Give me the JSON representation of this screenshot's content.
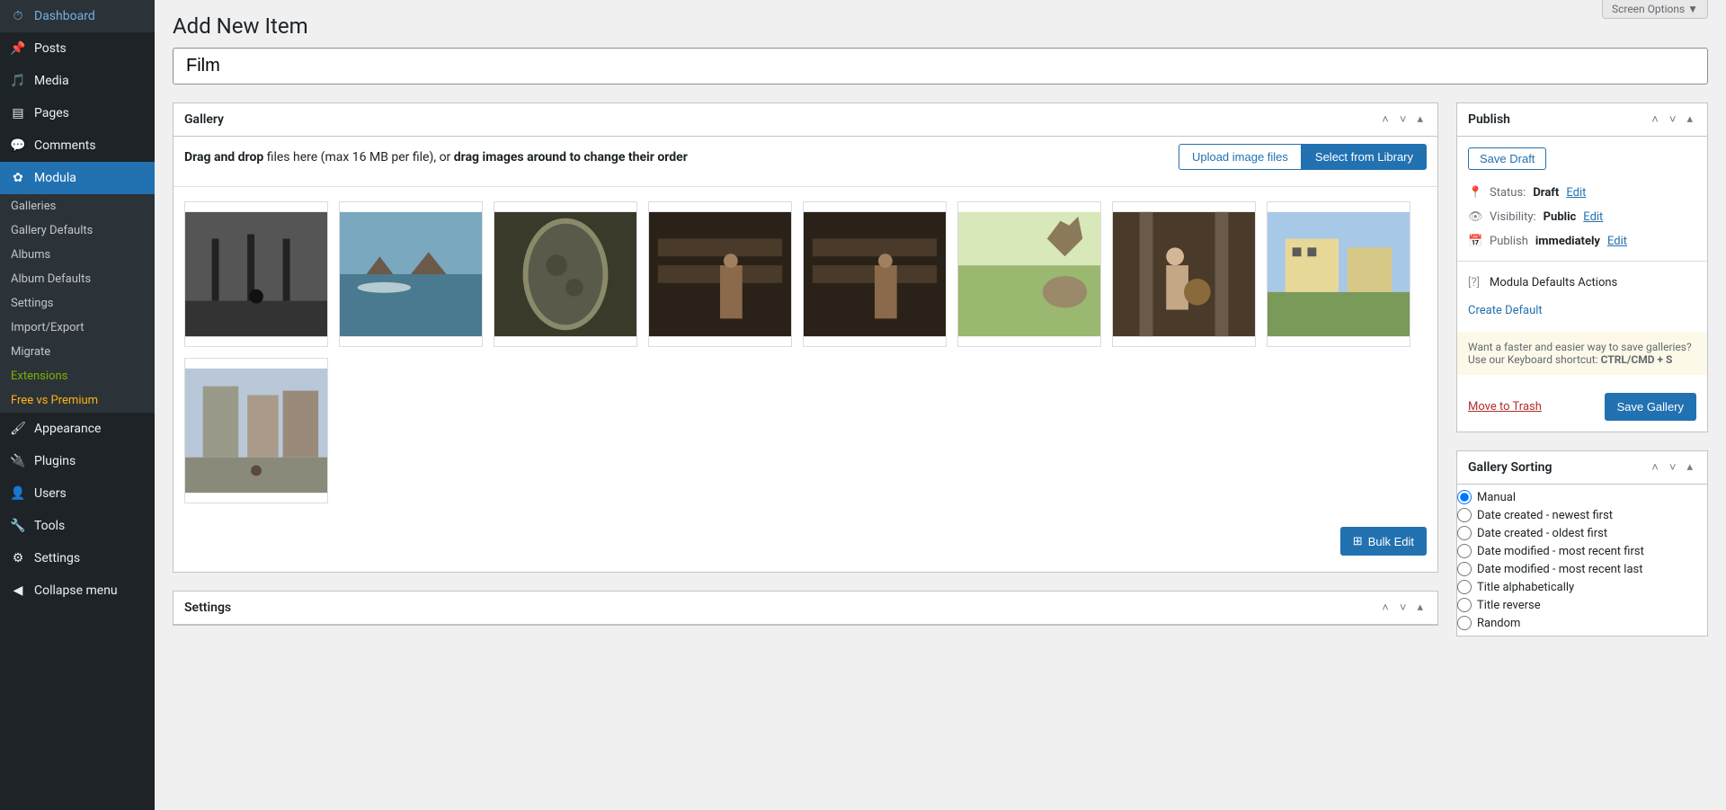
{
  "screenOptions": "Screen Options ▼",
  "sidebar": {
    "dashboard": "Dashboard",
    "posts": "Posts",
    "media": "Media",
    "pages": "Pages",
    "comments": "Comments",
    "modula": "Modula",
    "modulaSub": {
      "galleries": "Galleries",
      "galleryDefaults": "Gallery Defaults",
      "albums": "Albums",
      "albumDefaults": "Album Defaults",
      "settings": "Settings",
      "importExport": "Import/Export",
      "migrate": "Migrate",
      "extensions": "Extensions",
      "freeVsPremium": "Free vs Premium"
    },
    "appearance": "Appearance",
    "plugins": "Plugins",
    "users": "Users",
    "tools": "Tools",
    "settings": "Settings",
    "collapse": "Collapse menu"
  },
  "pageTitle": "Add New Item",
  "titleValue": "Film",
  "gallery": {
    "title": "Gallery",
    "uploadText1": "Drag and drop",
    "uploadText2": " files here (max 16 MB per file), or ",
    "uploadText3": "drag images around to change their order",
    "uploadBtn": "Upload image files",
    "libraryBtn": "Select from Library",
    "bulkEdit": "Bulk Edit"
  },
  "settings": {
    "title": "Settings"
  },
  "publish": {
    "title": "Publish",
    "saveDraft": "Save Draft",
    "statusLabel": "Status:",
    "statusValue": "Draft",
    "visibilityLabel": "Visibility:",
    "visibilityValue": "Public",
    "publishLabel": "Publish",
    "publishValue": "immediately",
    "edit": "Edit",
    "modulaDefaults": "Modula Defaults Actions",
    "createDefault": "Create Default",
    "tip1": "Want a faster and easier way to save galleries? Use our Keyboard shortcut: ",
    "tip2": "CTRL/CMD + S",
    "moveToTrash": "Move to Trash",
    "saveGallery": "Save Gallery"
  },
  "sorting": {
    "title": "Gallery Sorting",
    "options": {
      "manual": "Manual",
      "dateNewest": "Date created - newest first",
      "dateOldest": "Date created - oldest first",
      "modifiedFirst": "Date modified - most recent first",
      "modifiedLast": "Date modified - most recent last",
      "titleAlpha": "Title alphabetically",
      "titleReverse": "Title reverse",
      "random": "Random"
    }
  }
}
